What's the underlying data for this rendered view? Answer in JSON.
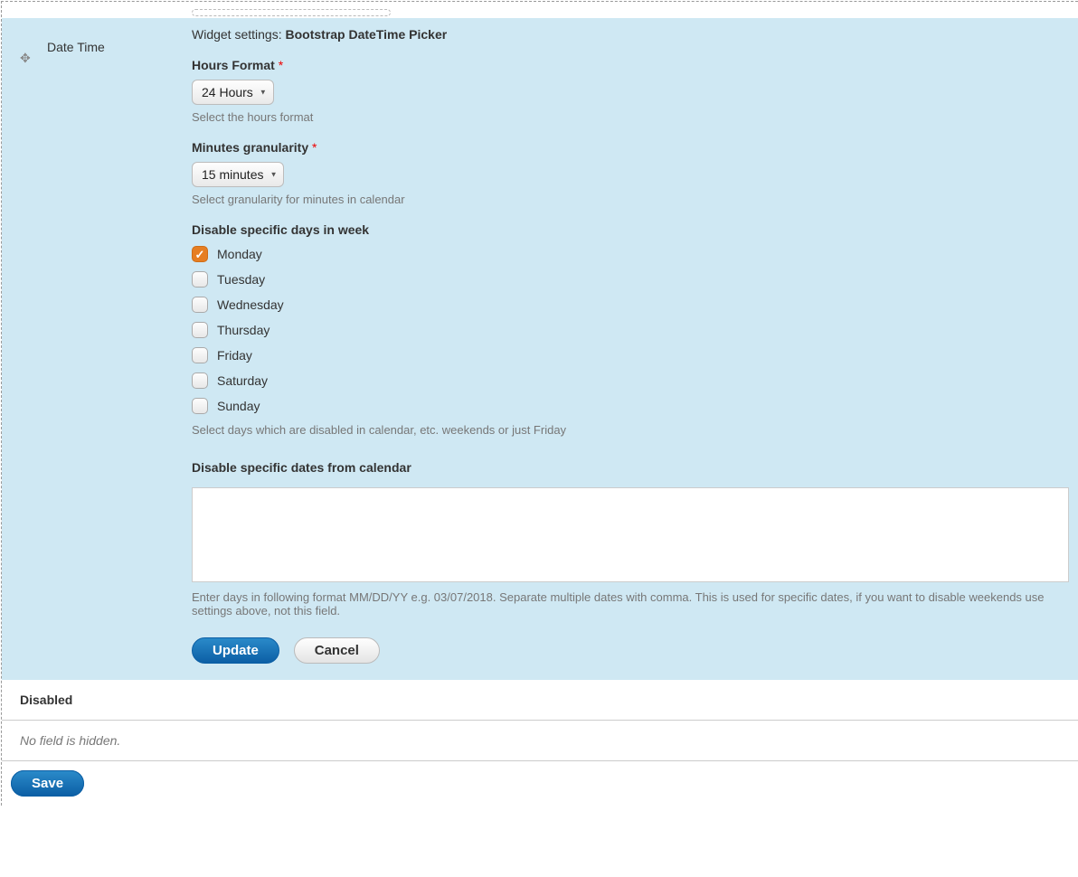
{
  "field_name": "Date Time",
  "widget_settings_prefix": "Widget settings: ",
  "widget_name": "Bootstrap DateTime Picker",
  "hours_format": {
    "label": "Hours Format",
    "value": "24 Hours",
    "help": "Select the hours format"
  },
  "minutes_granularity": {
    "label": "Minutes granularity",
    "value": "15 minutes",
    "help": "Select granularity for minutes in calendar"
  },
  "disable_days": {
    "label": "Disable specific days in week",
    "options": [
      {
        "label": "Monday",
        "checked": true
      },
      {
        "label": "Tuesday",
        "checked": false
      },
      {
        "label": "Wednesday",
        "checked": false
      },
      {
        "label": "Thursday",
        "checked": false
      },
      {
        "label": "Friday",
        "checked": false
      },
      {
        "label": "Saturday",
        "checked": false
      },
      {
        "label": "Sunday",
        "checked": false
      }
    ],
    "help": "Select days which are disabled in calendar, etc. weekends or just Friday"
  },
  "disable_dates": {
    "label": "Disable specific dates from calendar",
    "value": "",
    "help": "Enter days in following format MM/DD/YY e.g. 03/07/2018. Separate multiple dates with comma. This is used for specific dates, if you want to disable weekends use settings above, not this field."
  },
  "buttons": {
    "update": "Update",
    "cancel": "Cancel",
    "save": "Save"
  },
  "disabled_section": {
    "heading": "Disabled",
    "empty": "No field is hidden."
  }
}
